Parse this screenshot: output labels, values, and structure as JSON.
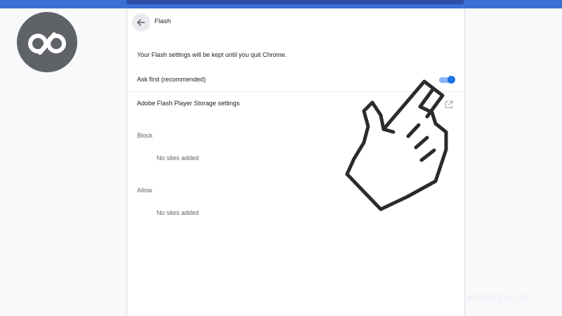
{
  "header": {
    "back_icon": "arrow-back-icon",
    "title": "Flash"
  },
  "settings": {
    "info_text": "Your Flash settings will be kept until you quit Chrome.",
    "ask_first_label": "Ask first (recommended)",
    "ask_first_enabled": true,
    "storage_link_label": "Adobe Flash Player Storage settings",
    "storage_link_icon": "open-in-new-icon"
  },
  "block": {
    "heading": "Block",
    "empty_text": "No sites added"
  },
  "allow": {
    "heading": "Allow",
    "empty_text": "No sites added"
  },
  "overlay": {
    "logo_icon": "infinity-logo-icon",
    "pointer_icon": "pointing-hand-icon",
    "watermark": "antidtinput.ru"
  },
  "colors": {
    "accent": "#1a73e8",
    "top_bar": "#3b6fd4",
    "logo_bg": "#5f6368"
  }
}
